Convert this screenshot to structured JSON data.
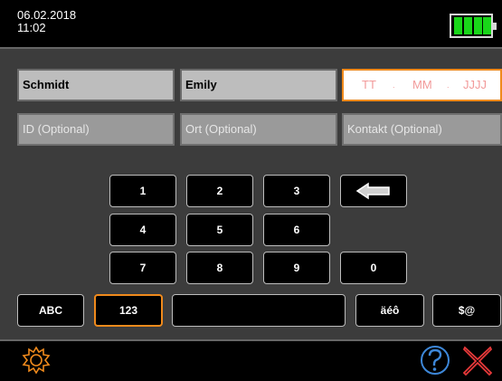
{
  "status": {
    "date": "06.02.2018",
    "time": "11:02"
  },
  "form": {
    "last_name": "Schmidt",
    "first_name": "Emily",
    "date_day_placeholder": "TT",
    "date_month_placeholder": "MM",
    "date_year_placeholder": "JJJJ",
    "id_placeholder": "ID (Optional)",
    "place_placeholder": "Ort (Optional)",
    "contact_placeholder": "Kontakt (Optional)"
  },
  "keypad": {
    "k1": "1",
    "k2": "2",
    "k3": "3",
    "k4": "4",
    "k5": "5",
    "k6": "6",
    "k7": "7",
    "k8": "8",
    "k9": "9",
    "k0": "0"
  },
  "modes": {
    "abc": "ABC",
    "num": "123",
    "umlaut": "äéô",
    "symbols": "$@"
  },
  "icons": {
    "settings": "gear-icon",
    "help": "question-icon",
    "close": "close-icon",
    "backspace": "backspace-arrow-icon",
    "battery": "battery-icon"
  },
  "colors": {
    "accent": "#f08a1c",
    "battery_fill": "#19d619",
    "close": "#e8393a",
    "help": "#3d87d8",
    "date_placeholder": "#f29a9a"
  }
}
